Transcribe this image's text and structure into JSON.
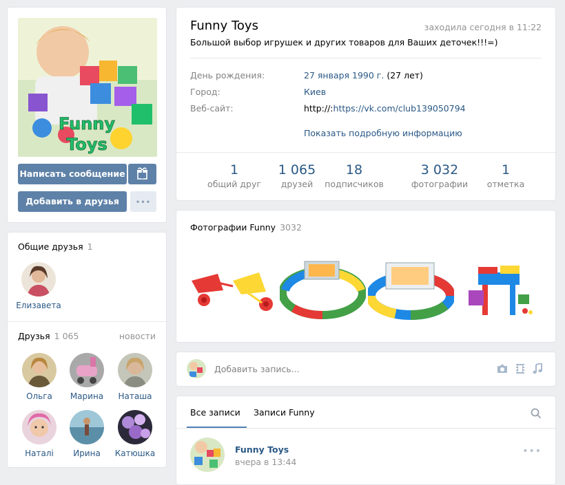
{
  "profile": {
    "name": "Funny Toys",
    "last_seen": "заходила сегодня в 11:22",
    "status": "Большой выбор игрушек и других товаров для Ваших деточек!!!=)",
    "avatar_text_line1": "Funny",
    "avatar_text_line2": "Toys"
  },
  "actions": {
    "message_label": "Написать сообщение",
    "add_friend_label": "Добавить в друзья",
    "more_label": "•••"
  },
  "info": {
    "birthday_label": "День рождения:",
    "birthday_date": "27 января 1990 г.",
    "birthday_age": " (27 лет)",
    "city_label": "Город:",
    "city_value": "Киев",
    "website_label": "Веб-сайт:",
    "website_prefix": "http://:",
    "website_link": "https://vk.com/club139050794",
    "show_more": "Показать подробную информацию"
  },
  "counters": [
    {
      "num": "1",
      "label": "общий друг"
    },
    {
      "num": "1 065",
      "label": "друзей"
    },
    {
      "num": "18",
      "label": "подписчиков"
    },
    {
      "num": "3 032",
      "label": "фотографии"
    },
    {
      "num": "1",
      "label": "отметка"
    }
  ],
  "mutual": {
    "title": "Общие друзья",
    "count": "1",
    "friend": "Елизавета"
  },
  "friends": {
    "title": "Друзья",
    "count": "1 065",
    "news_link": "новости",
    "items": [
      "Ольга",
      "Марина",
      "Наташа",
      "Наталі",
      "Ирина",
      "Катюшка"
    ]
  },
  "photos": {
    "title": "Фотографии Funny",
    "count": "3032"
  },
  "post": {
    "placeholder": "Добавить запись..."
  },
  "wall": {
    "tab_all": "Все записи",
    "tab_owner": "Записи Funny",
    "post_author": "Funny Toys",
    "post_time": "вчера в 13:44",
    "post_more": "•••"
  },
  "colors": {
    "background": "#edeef0",
    "button_blue": "#5e81a8",
    "link": "#2a5885",
    "muted": "#828282"
  }
}
